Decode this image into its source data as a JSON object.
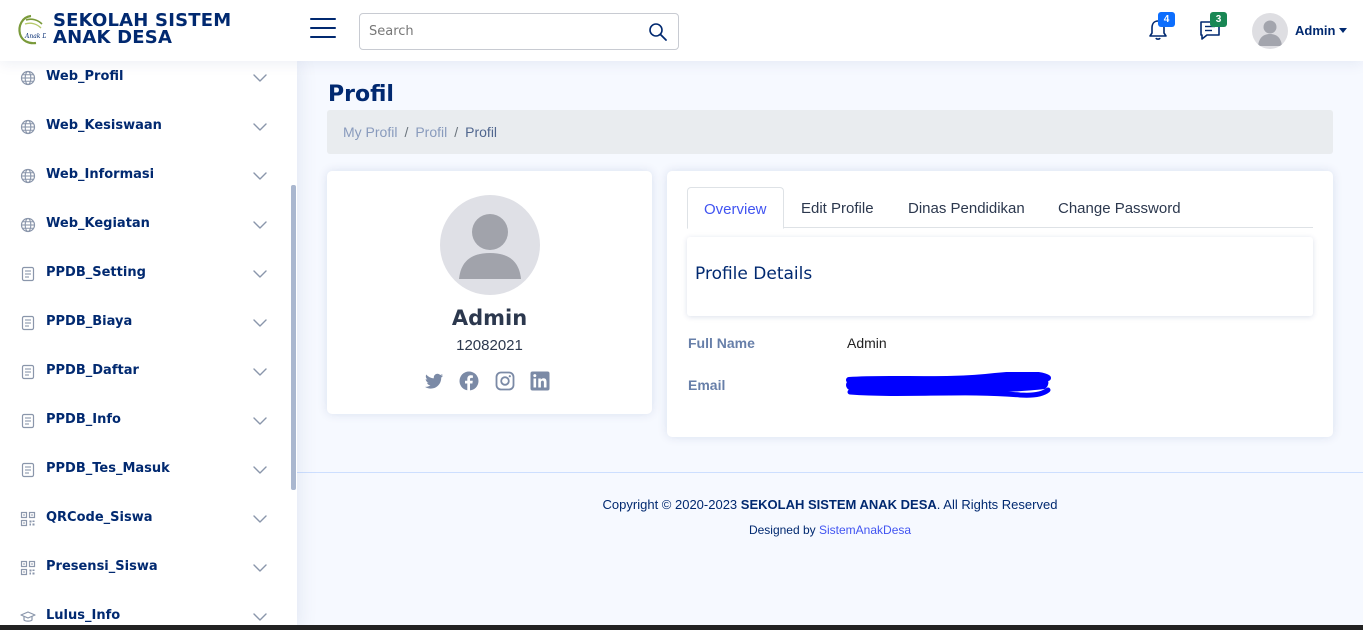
{
  "header": {
    "brand": "SEKOLAH SISTEM ANAK DESA",
    "search_placeholder": "Search",
    "notifications_count": "4",
    "messages_count": "3",
    "user_name": "Admin"
  },
  "sidebar": {
    "items": [
      {
        "label": "Web_Profil",
        "icon": "globe-icon"
      },
      {
        "label": "Web_Kesiswaan",
        "icon": "globe-icon"
      },
      {
        "label": "Web_Informasi",
        "icon": "globe-icon"
      },
      {
        "label": "Web_Kegiatan",
        "icon": "globe-icon"
      },
      {
        "label": "PPDB_Setting",
        "icon": "document-icon"
      },
      {
        "label": "PPDB_Biaya",
        "icon": "document-icon"
      },
      {
        "label": "PPDB_Daftar",
        "icon": "document-icon"
      },
      {
        "label": "PPDB_Info",
        "icon": "document-icon"
      },
      {
        "label": "PPDB_Tes_Masuk",
        "icon": "document-icon"
      },
      {
        "label": "QRCode_Siswa",
        "icon": "qr-code-icon"
      },
      {
        "label": "Presensi_Siswa",
        "icon": "qr-code-icon"
      },
      {
        "label": "Lulus_Info",
        "icon": "graduation-cap-icon"
      }
    ]
  },
  "main": {
    "page_title": "Profil",
    "breadcrumb": [
      "My Profil",
      "Profil",
      "Profil"
    ],
    "profile_card": {
      "name": "Admin",
      "id": "12082021",
      "socials": [
        "twitter-icon",
        "facebook-icon",
        "instagram-icon",
        "linkedin-icon"
      ]
    },
    "tabs": [
      "Overview",
      "Edit Profile",
      "Dinas Pendidikan",
      "Change Password"
    ],
    "active_tab": "Overview",
    "section_title": "Profile Details",
    "details": [
      {
        "label": "Full Name",
        "value": "Admin"
      },
      {
        "label": "Email",
        "value": ""
      }
    ]
  },
  "footer": {
    "copyright_prefix": "Copyright © 2020-2023 ",
    "copyright_brand": "SEKOLAH SISTEM ANAK DESA",
    "copyright_suffix": ". All Rights Reserved",
    "designed_by": "Designed by ",
    "designer": "SistemAnakDesa"
  },
  "colors": {
    "primary": "#012970",
    "accent": "#4154f1",
    "background": "#f6f9ff",
    "badge_blue": "#0d6efd",
    "badge_green": "#198754",
    "redaction": "#0000ff"
  }
}
